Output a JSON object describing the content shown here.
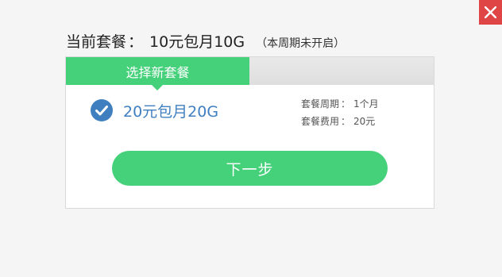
{
  "header": {
    "current_plan_label": "当前套餐",
    "colon": "：",
    "current_plan_value": "10元包月10G",
    "status_note": "（本周期未开启）"
  },
  "tabs": [
    {
      "label": "选择新套餐",
      "active": true
    }
  ],
  "plan": {
    "name": "20元包月20G",
    "selected": true,
    "details": [
      {
        "key": "套餐周期",
        "sep": "：",
        "value": "1个月"
      },
      {
        "key": "套餐费用",
        "sep": "：",
        "value": "20元"
      }
    ]
  },
  "actions": {
    "next_label": "下一步"
  },
  "icons": {
    "close": "close-icon",
    "check": "check-circle-icon"
  },
  "colors": {
    "accent_green": "#45d07a",
    "close_red": "#e04545",
    "check_blue": "#3f7fc0"
  }
}
